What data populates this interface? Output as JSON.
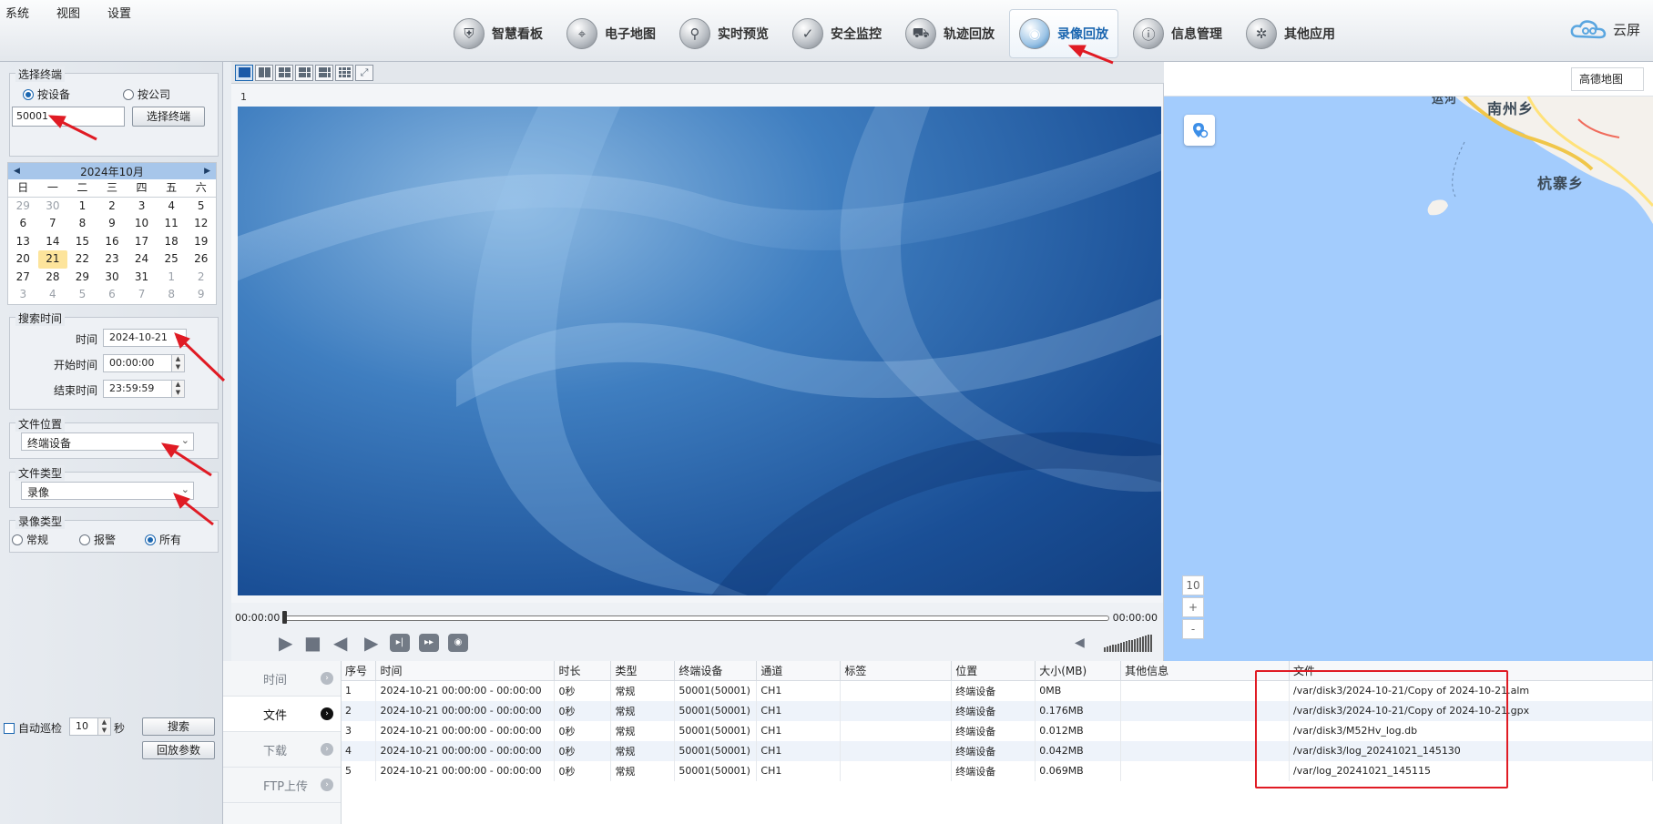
{
  "menu": [
    "系统",
    "视图",
    "设置"
  ],
  "nav_tabs": [
    {
      "label": "智慧看板",
      "icon": "shield-icon",
      "active": false
    },
    {
      "label": "电子地图",
      "icon": "map-pin-icon",
      "active": false
    },
    {
      "label": "实时预览",
      "icon": "magnifier-icon",
      "active": false
    },
    {
      "label": "安全监控",
      "icon": "shield-check-icon",
      "active": false
    },
    {
      "label": "轨迹回放",
      "icon": "track-icon",
      "active": false
    },
    {
      "label": "录像回放",
      "icon": "video-replay-icon",
      "active": true
    },
    {
      "label": "信息管理",
      "icon": "info-icon",
      "active": false
    },
    {
      "label": "其他应用",
      "icon": "apps-icon",
      "active": false
    }
  ],
  "brand": {
    "name": "云屏"
  },
  "terminal": {
    "title": "选择终端",
    "radio_device": "按设备",
    "radio_company": "按公司",
    "input_value": "50001",
    "select_button": "选择终端"
  },
  "calendar": {
    "month_label": "2024年10月",
    "weekdays": [
      "日",
      "一",
      "二",
      "三",
      "四",
      "五",
      "六"
    ],
    "days": [
      [
        "29",
        "30",
        "1",
        "2",
        "3",
        "4",
        "5"
      ],
      [
        "6",
        "7",
        "8",
        "9",
        "10",
        "11",
        "12"
      ],
      [
        "13",
        "14",
        "15",
        "16",
        "17",
        "18",
        "19"
      ],
      [
        "20",
        "21",
        "22",
        "23",
        "24",
        "25",
        "26"
      ],
      [
        "27",
        "28",
        "29",
        "30",
        "31",
        "1",
        "2"
      ],
      [
        "3",
        "4",
        "5",
        "6",
        "7",
        "8",
        "9"
      ]
    ],
    "today": "21"
  },
  "search_time": {
    "title": "搜索时间",
    "date_label": "时间",
    "date_value": "2024-10-21",
    "start_label": "开始时间",
    "start_value": "00:00:00",
    "end_label": "结束时间",
    "end_value": "23:59:59"
  },
  "file_location": {
    "title": "文件位置",
    "value": "终端设备"
  },
  "file_type": {
    "title": "文件类型",
    "value": "录像"
  },
  "record_type": {
    "title": "录像类型",
    "options": [
      "常规",
      "报警",
      "所有"
    ],
    "selected": "所有"
  },
  "bottom_left": {
    "auto_patrol": "自动巡检",
    "patrol_value": "10",
    "patrol_unit": "秒",
    "search_button": "搜索",
    "params_button": "回放参数"
  },
  "video": {
    "window_label": "1",
    "time_start": "00:00:00",
    "time_end": "00:00:00"
  },
  "map": {
    "type": "高德地图",
    "cities": [
      "南州乡",
      "杭寨乡",
      "运河"
    ],
    "zoom_level": "10",
    "zoom_in": "+",
    "zoom_out": "-"
  },
  "bottom_tabs": [
    "时间",
    "文件",
    "下载",
    "FTP上传"
  ],
  "active_bottom_tab": "文件",
  "table": {
    "headers": [
      "序号",
      "时间",
      "时长",
      "类型",
      "终端设备",
      "通道",
      "标签",
      "位置",
      "大小(MB)",
      "其他信息",
      "文件"
    ],
    "rows": [
      [
        "1",
        "2024-10-21 00:00:00 - 00:00:00",
        "0秒",
        "常规",
        "50001(50001)",
        "CH1",
        "",
        "终端设备",
        "0MB",
        "",
        "/var/disk3/2024-10-21/Copy of 2024-10-21.alm"
      ],
      [
        "2",
        "2024-10-21 00:00:00 - 00:00:00",
        "0秒",
        "常规",
        "50001(50001)",
        "CH1",
        "",
        "终端设备",
        "0.176MB",
        "",
        "/var/disk3/2024-10-21/Copy of 2024-10-21.gpx"
      ],
      [
        "3",
        "2024-10-21 00:00:00 - 00:00:00",
        "0秒",
        "常规",
        "50001(50001)",
        "CH1",
        "",
        "终端设备",
        "0.012MB",
        "",
        "/var/disk3/M52Hv_log.db"
      ],
      [
        "4",
        "2024-10-21 00:00:00 - 00:00:00",
        "0秒",
        "常规",
        "50001(50001)",
        "CH1",
        "",
        "终端设备",
        "0.042MB",
        "",
        "/var/disk3/log_20241021_145130"
      ],
      [
        "5",
        "2024-10-21 00:00:00 - 00:00:00",
        "0秒",
        "常规",
        "50001(50001)",
        "CH1",
        "",
        "终端设备",
        "0.069MB",
        "",
        "/var/log_20241021_145115"
      ]
    ]
  },
  "colors": {
    "accent": "#1b66b0",
    "annotation": "#e01b24",
    "map_water": "#a3ccfd",
    "today": "#fde49b"
  }
}
